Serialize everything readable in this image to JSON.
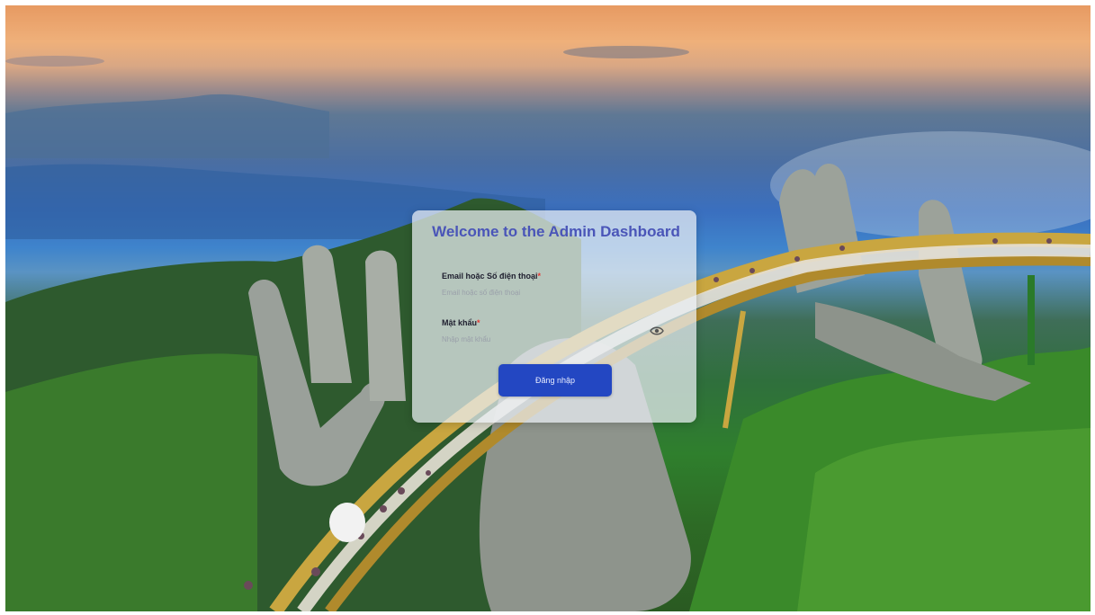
{
  "login": {
    "title": "Welcome to the Admin Dashboard",
    "email_label": "Email hoặc Số điện thoại",
    "email_placeholder": "Email hoặc số điện thoại",
    "required_mark": "*",
    "password_label": "Mật khẩu",
    "password_placeholder": "Nhập mật khẩu",
    "login_button": "Đăng nhập"
  },
  "colors": {
    "title": "#4a55b8",
    "button": "#2347c2",
    "required": "#e53935"
  },
  "icons": {
    "password_toggle": "eye-icon"
  }
}
